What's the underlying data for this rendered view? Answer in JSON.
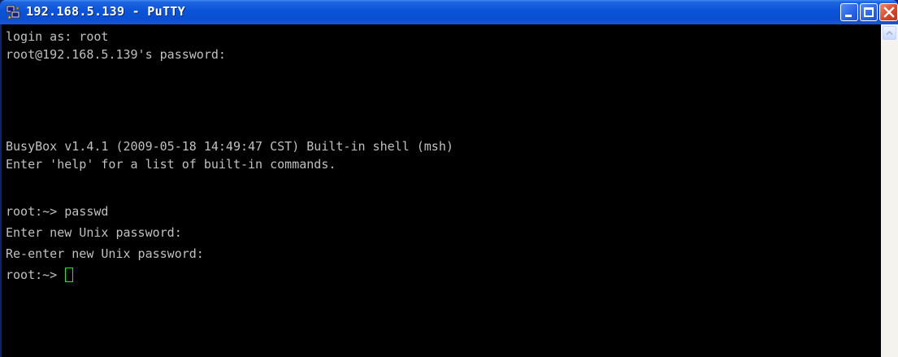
{
  "window": {
    "title": "192.168.5.139 - PuTTY",
    "app_icon": "putty-icon"
  },
  "titlebar_buttons": {
    "minimize_icon": "minimize-icon",
    "maximize_icon": "maximize-icon",
    "close_icon": "close-icon"
  },
  "terminal": {
    "lines": [
      "login as: root",
      "root@192.168.5.139's password:",
      "",
      "",
      "BusyBox v1.4.1 (2009-05-18 14:49:47 CST) Built-in shell (msh)",
      "Enter 'help' for a list of built-in commands.",
      "",
      "root:~> passwd",
      "Enter new Unix password:",
      "Re-enter new Unix password:"
    ],
    "prompt_line": "root:~> ",
    "cursor_color": "#00ff00"
  },
  "colors": {
    "titlebar": "#0a53d8",
    "terminal_bg": "#000000",
    "terminal_fg": "#c0c0c0",
    "close_button": "#d9462a"
  }
}
